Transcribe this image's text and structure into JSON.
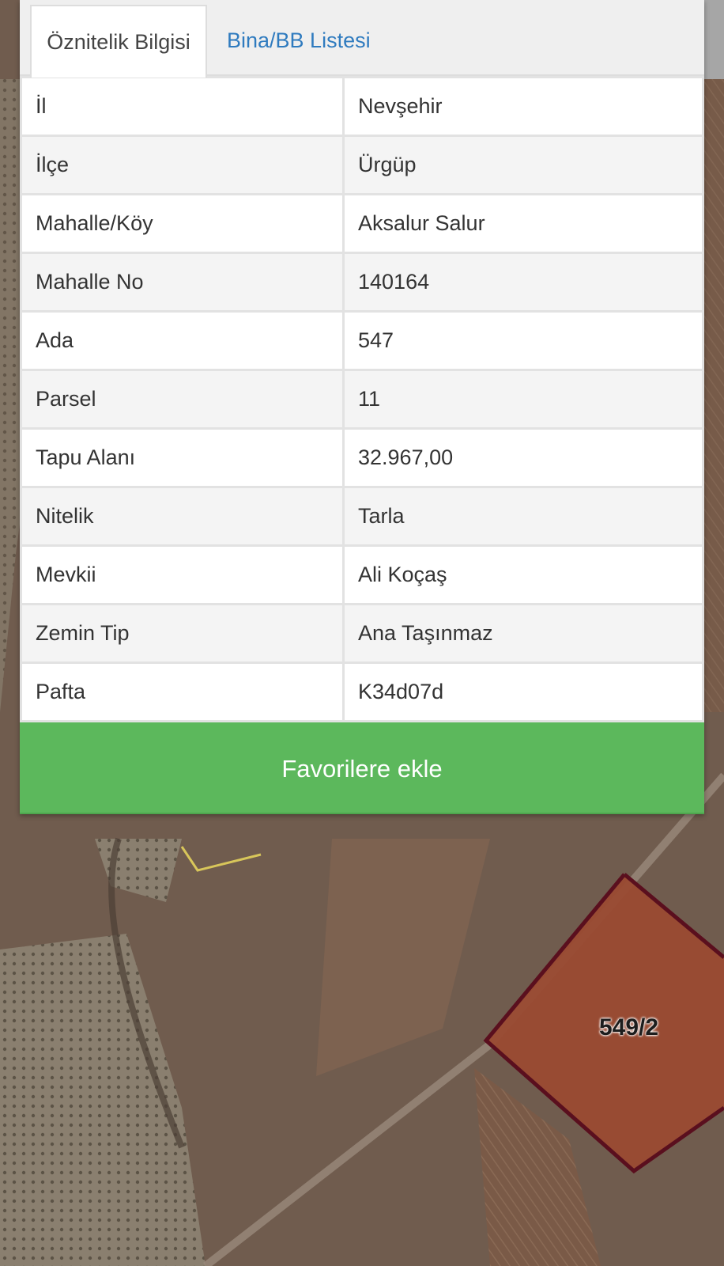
{
  "tabs": [
    {
      "label": "Öznitelik Bilgisi",
      "active": true
    },
    {
      "label": "Bina/BB Listesi",
      "active": false
    }
  ],
  "attributes": [
    {
      "key": "İl",
      "value": "Nevşehir"
    },
    {
      "key": "İlçe",
      "value": "Ürgüp"
    },
    {
      "key": "Mahalle/Köy",
      "value": "Aksalur Salur"
    },
    {
      "key": "Mahalle No",
      "value": "140164"
    },
    {
      "key": "Ada",
      "value": "547"
    },
    {
      "key": "Parsel",
      "value": "11"
    },
    {
      "key": "Tapu Alanı",
      "value": "32.967,00"
    },
    {
      "key": "Nitelik",
      "value": "Tarla"
    },
    {
      "key": "Mevkii",
      "value": "Ali Koçaş"
    },
    {
      "key": "Zemin Tip",
      "value": "Ana Taşınmaz"
    },
    {
      "key": "Pafta",
      "value": "K34d07d"
    }
  ],
  "favorite_button": {
    "label": "Favorilere ekle"
  },
  "map": {
    "parcel_label": "549/2"
  },
  "colors": {
    "accent_green": "#5cb85c",
    "tab_link": "#2f7bbf",
    "parcel_fill": "#9a4a32",
    "parcel_border": "#5a0f1e",
    "map_base": "#6e5a4c"
  }
}
